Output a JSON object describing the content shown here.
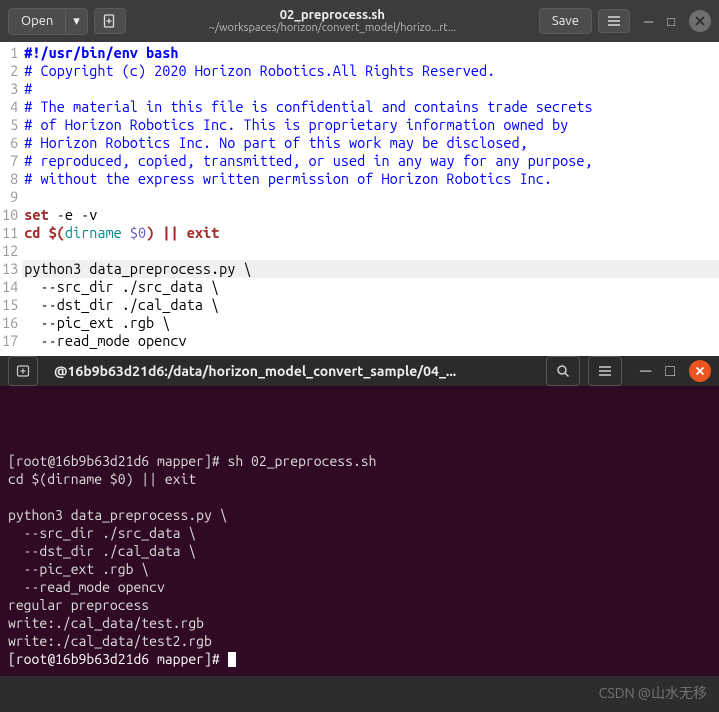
{
  "editor": {
    "open_label": "Open",
    "save_label": "Save",
    "title": "02_preprocess.sh",
    "subtitle": "~/workspaces/horizon/convert_model/horizo...rt...",
    "lines": [
      {
        "n": "1",
        "seg": [
          {
            "c": "c-sh",
            "t": "#!/usr/bin/env bash"
          }
        ]
      },
      {
        "n": "2",
        "seg": [
          {
            "c": "c-cm",
            "t": "# Copyright (c) 2020 Horizon Robotics.All Rights Reserved."
          }
        ]
      },
      {
        "n": "3",
        "seg": [
          {
            "c": "c-cm",
            "t": "#"
          }
        ]
      },
      {
        "n": "4",
        "seg": [
          {
            "c": "c-cm",
            "t": "# The material in this file is confidential and contains trade secrets"
          }
        ]
      },
      {
        "n": "5",
        "seg": [
          {
            "c": "c-cm",
            "t": "# of Horizon Robotics Inc. This is proprietary information owned by"
          }
        ]
      },
      {
        "n": "6",
        "seg": [
          {
            "c": "c-cm",
            "t": "# Horizon Robotics Inc. No part of this work may be disclosed,"
          }
        ]
      },
      {
        "n": "7",
        "seg": [
          {
            "c": "c-cm",
            "t": "# reproduced, copied, transmitted, or used in any way for any purpose,"
          }
        ]
      },
      {
        "n": "8",
        "seg": [
          {
            "c": "c-cm",
            "t": "# without the express written permission of Horizon Robotics Inc."
          }
        ]
      },
      {
        "n": "9",
        "seg": []
      },
      {
        "n": "10",
        "seg": [
          {
            "c": "c-kw",
            "t": "set"
          },
          {
            "c": "c-py",
            "t": " -e -v"
          }
        ]
      },
      {
        "n": "11",
        "seg": [
          {
            "c": "c-kw",
            "t": "cd "
          },
          {
            "c": "c-red",
            "t": "$("
          },
          {
            "c": "c-fn",
            "t": "dirname "
          },
          {
            "c": "c-var",
            "t": "$0"
          },
          {
            "c": "c-red",
            "t": ")"
          },
          {
            "c": "c-py",
            "t": " "
          },
          {
            "c": "c-op",
            "t": "||"
          },
          {
            "c": "c-py",
            "t": " "
          },
          {
            "c": "c-kw",
            "t": "exit"
          }
        ]
      },
      {
        "n": "12",
        "seg": []
      },
      {
        "n": "13",
        "hl": true,
        "seg": [
          {
            "c": "c-py",
            "t": "python3 data_preprocess.py \\"
          }
        ]
      },
      {
        "n": "14",
        "seg": [
          {
            "c": "c-py",
            "t": "  --src_dir ./src_data \\"
          }
        ]
      },
      {
        "n": "15",
        "seg": [
          {
            "c": "c-py",
            "t": "  --dst_dir ./cal_data \\"
          }
        ]
      },
      {
        "n": "16",
        "seg": [
          {
            "c": "c-py",
            "t": "  --pic_ext .rgb \\"
          }
        ]
      },
      {
        "n": "17",
        "seg": [
          {
            "c": "c-py",
            "t": "  --read_mode opencv"
          }
        ]
      }
    ]
  },
  "terminal": {
    "title": "@16b9b63d21d6:/data/horizon_model_convert_sample/04_...",
    "lines": [
      "[root@16b9b63d21d6 mapper]# sh 02_preprocess.sh",
      "cd $(dirname $0) || exit",
      "",
      "python3 data_preprocess.py \\",
      "  --src_dir ./src_data \\",
      "  --dst_dir ./cal_data \\",
      "  --pic_ext .rgb \\",
      "  --read_mode opencv",
      "regular preprocess",
      "write:./cal_data/test.rgb",
      "write:./cal_data/test2.rgb"
    ],
    "prompt": "[root@16b9b63d21d6 mapper]# "
  },
  "watermark": "CSDN @山水无移"
}
